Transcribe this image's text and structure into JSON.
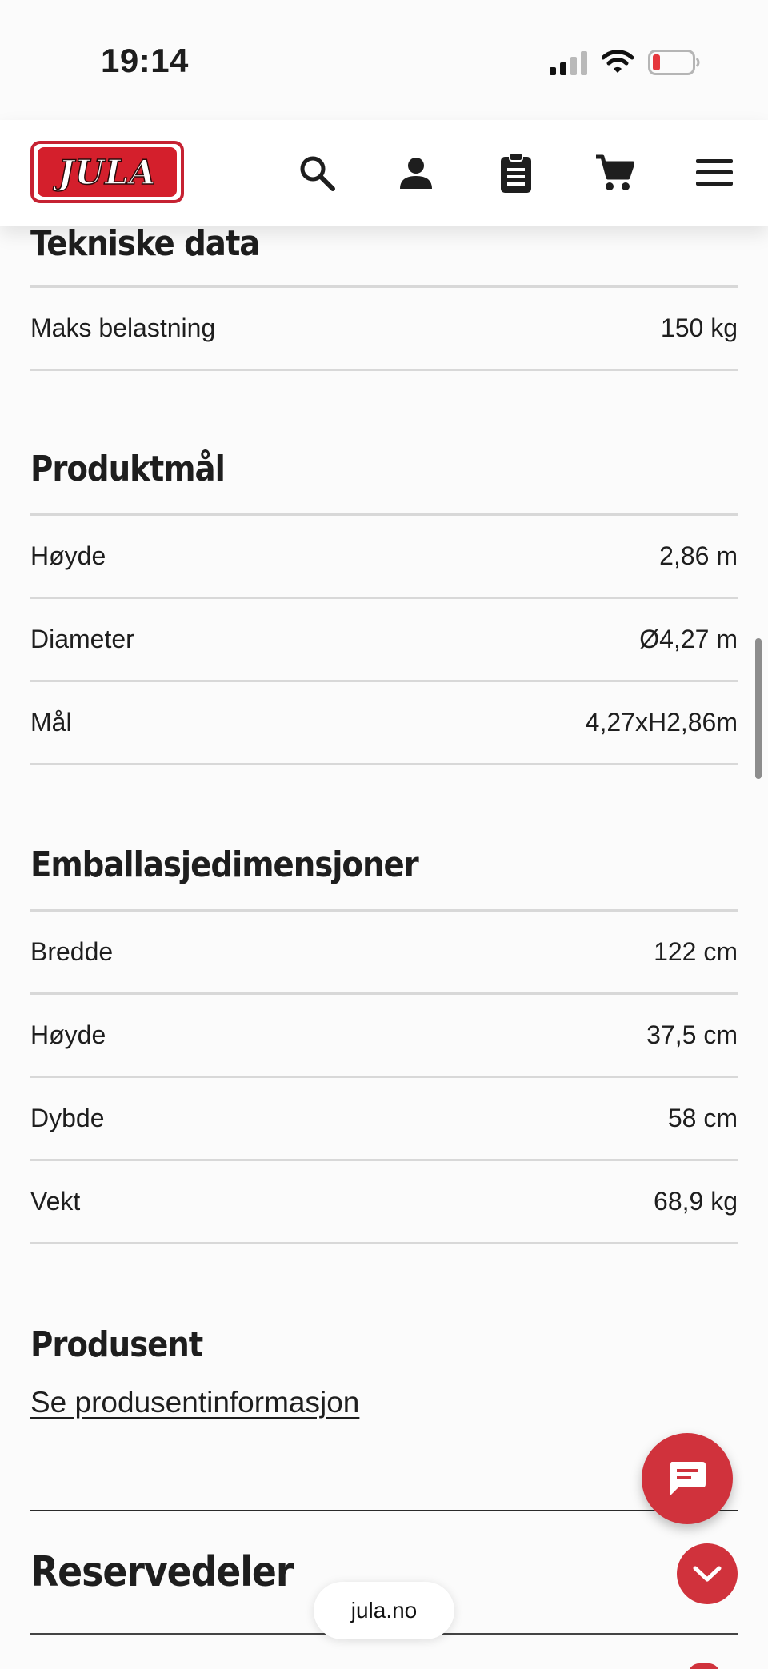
{
  "status_bar": {
    "time": "19:14"
  },
  "header": {
    "logo_text": "JULA",
    "brand_color": "#d41f2c",
    "icons": [
      "search-icon",
      "account-icon",
      "clipboard-list-icon",
      "cart-icon",
      "menu-icon"
    ]
  },
  "tekniske_data": {
    "title": "Tekniske data",
    "rows": [
      {
        "label": "Maks belastning",
        "value": "150 kg"
      }
    ]
  },
  "produktmal": {
    "title": "Produktmål",
    "rows": [
      {
        "label": "Høyde",
        "value": "2,86 m"
      },
      {
        "label": "Diameter",
        "value": "Ø4,27 m"
      },
      {
        "label": "Mål",
        "value": "4,27xH2,86m"
      }
    ]
  },
  "emballasje": {
    "title": "Emballasjedimensjoner",
    "rows": [
      {
        "label": "Bredde",
        "value": "122 cm"
      },
      {
        "label": "Høyde",
        "value": "37,5 cm"
      },
      {
        "label": "Dybde",
        "value": "58 cm"
      },
      {
        "label": "Vekt",
        "value": "68,9 kg"
      }
    ]
  },
  "produsent": {
    "title": "Produsent",
    "link": "Se produsentinformasjon"
  },
  "reservedeler": {
    "title": "Reservedeler"
  },
  "browser": {
    "url": "jula.no"
  },
  "accent_color": "#d0323c"
}
